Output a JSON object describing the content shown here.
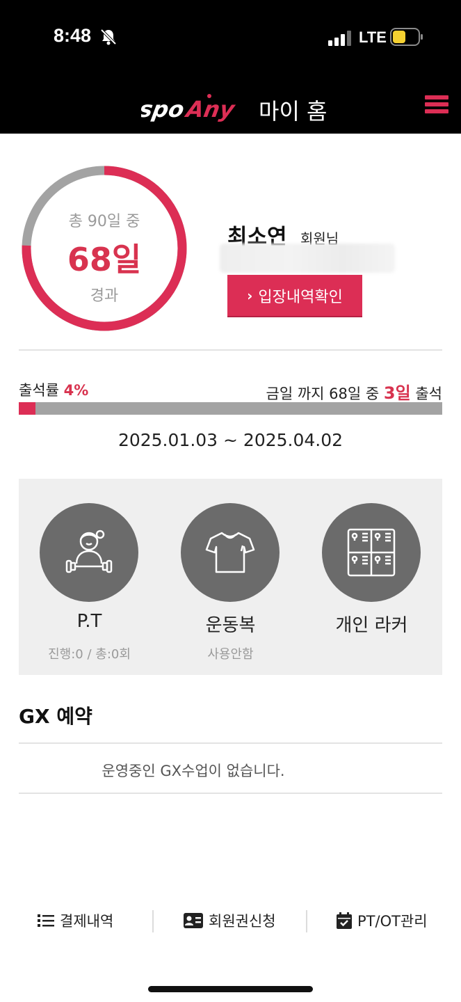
{
  "status_bar": {
    "time": "8:48",
    "network": "LTE"
  },
  "header": {
    "brand": "spoAny",
    "title": "마이 홈"
  },
  "membership": {
    "total_label": "총 90일 중",
    "elapsed_days": "68일",
    "elapsed_label": "경과",
    "elapsed_fraction": 0.7556,
    "member_name": "최소연",
    "member_suffix": "회원님",
    "entry_button": "입장내역확인"
  },
  "attendance": {
    "rate_label": "출석률",
    "rate_value": "4%",
    "rate_fraction": 0.04,
    "summary_prefix": "금일 까지 68일 중",
    "summary_count": "3일",
    "summary_suffix": "출석",
    "date_range": "2025.01.03 ~ 2025.04.02"
  },
  "services": [
    {
      "title": "P.T",
      "subtitle": "진행:0 / 총:0회",
      "icon": "trainer-icon"
    },
    {
      "title": "운동복",
      "subtitle": "사용안함",
      "icon": "tshirt-icon"
    },
    {
      "title": "개인 라커",
      "subtitle": "",
      "icon": "locker-icon"
    }
  ],
  "gx": {
    "title": "GX 예약",
    "empty_message": "운영중인 GX수업이 없습니다."
  },
  "bottom_nav": [
    {
      "label": "결제내역",
      "icon": "list-icon"
    },
    {
      "label": "회원권신청",
      "icon": "id-card-icon"
    },
    {
      "label": "PT/OT관리",
      "icon": "calendar-check-icon"
    }
  ],
  "colors": {
    "accent": "#dc2e55",
    "ring_track": "#a3a3a3",
    "panel": "#efefef"
  }
}
